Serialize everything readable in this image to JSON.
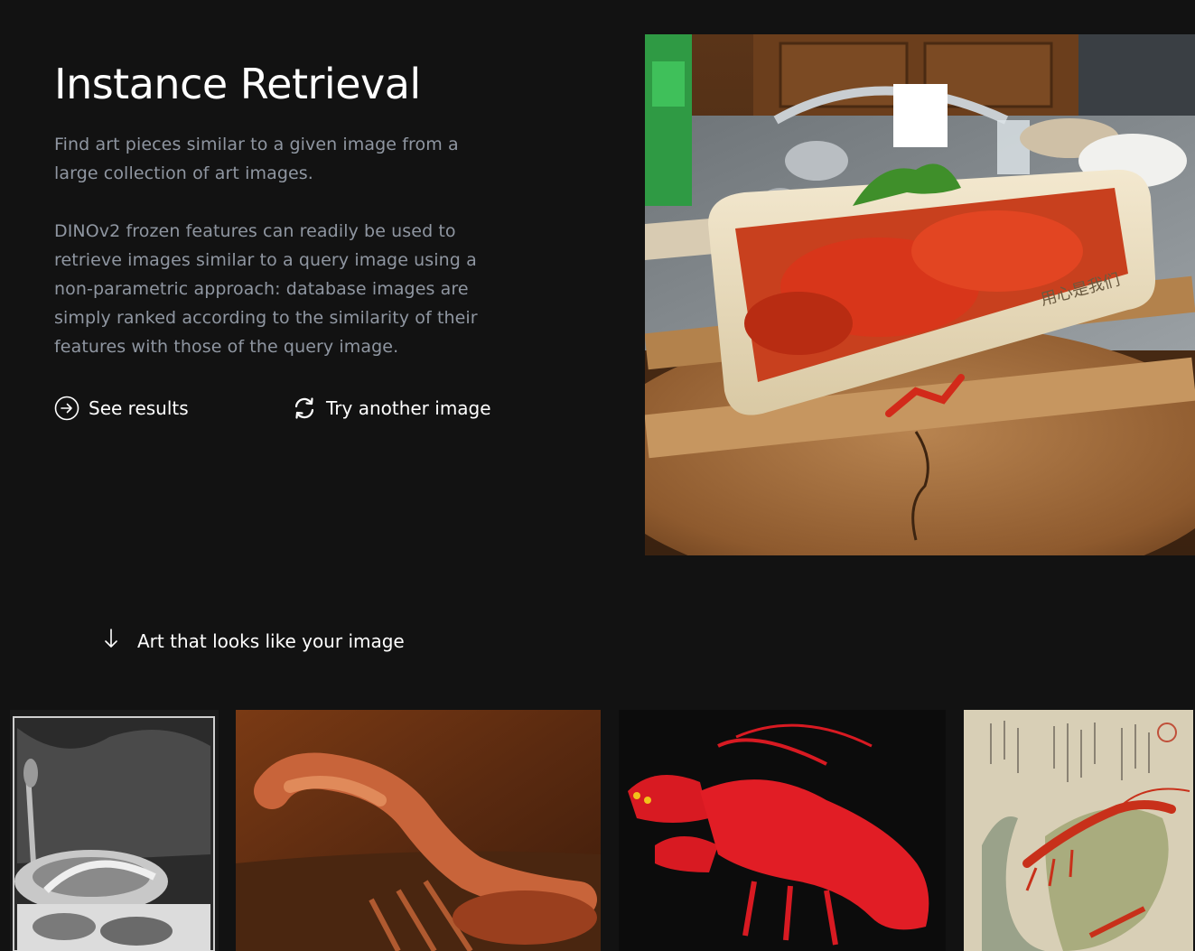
{
  "section": {
    "title": "Instance Retrieval",
    "description_1": "Find art pieces similar to a given image from a large collection of art images.",
    "description_2": "DINOv2 frozen features can readily be used to retrieve images similar to a query image using a non-parametric approach: database images are simply ranked according to the similarity of their features with those of the query image."
  },
  "actions": {
    "see_results": {
      "label": "See results",
      "icon": "arrow-right-circle-icon"
    },
    "try_another": {
      "label": "Try another image",
      "icon": "refresh-icon"
    }
  },
  "query_image": {
    "subject": "crayfish dish on wooden lazy susan"
  },
  "results": {
    "heading": "Art that looks like your image",
    "heading_icon": "arrow-down-icon",
    "items": [
      {
        "subject": "black-and-white still life with lobster platter"
      },
      {
        "subject": "oil painting of a lobster"
      },
      {
        "subject": "red lobster on black background"
      },
      {
        "subject": "Japanese woodblock print of a lobster with calligraphy"
      }
    ]
  },
  "colors": {
    "background": "#121212",
    "text_primary": "#ffffff",
    "text_secondary": "#8f96a1"
  }
}
